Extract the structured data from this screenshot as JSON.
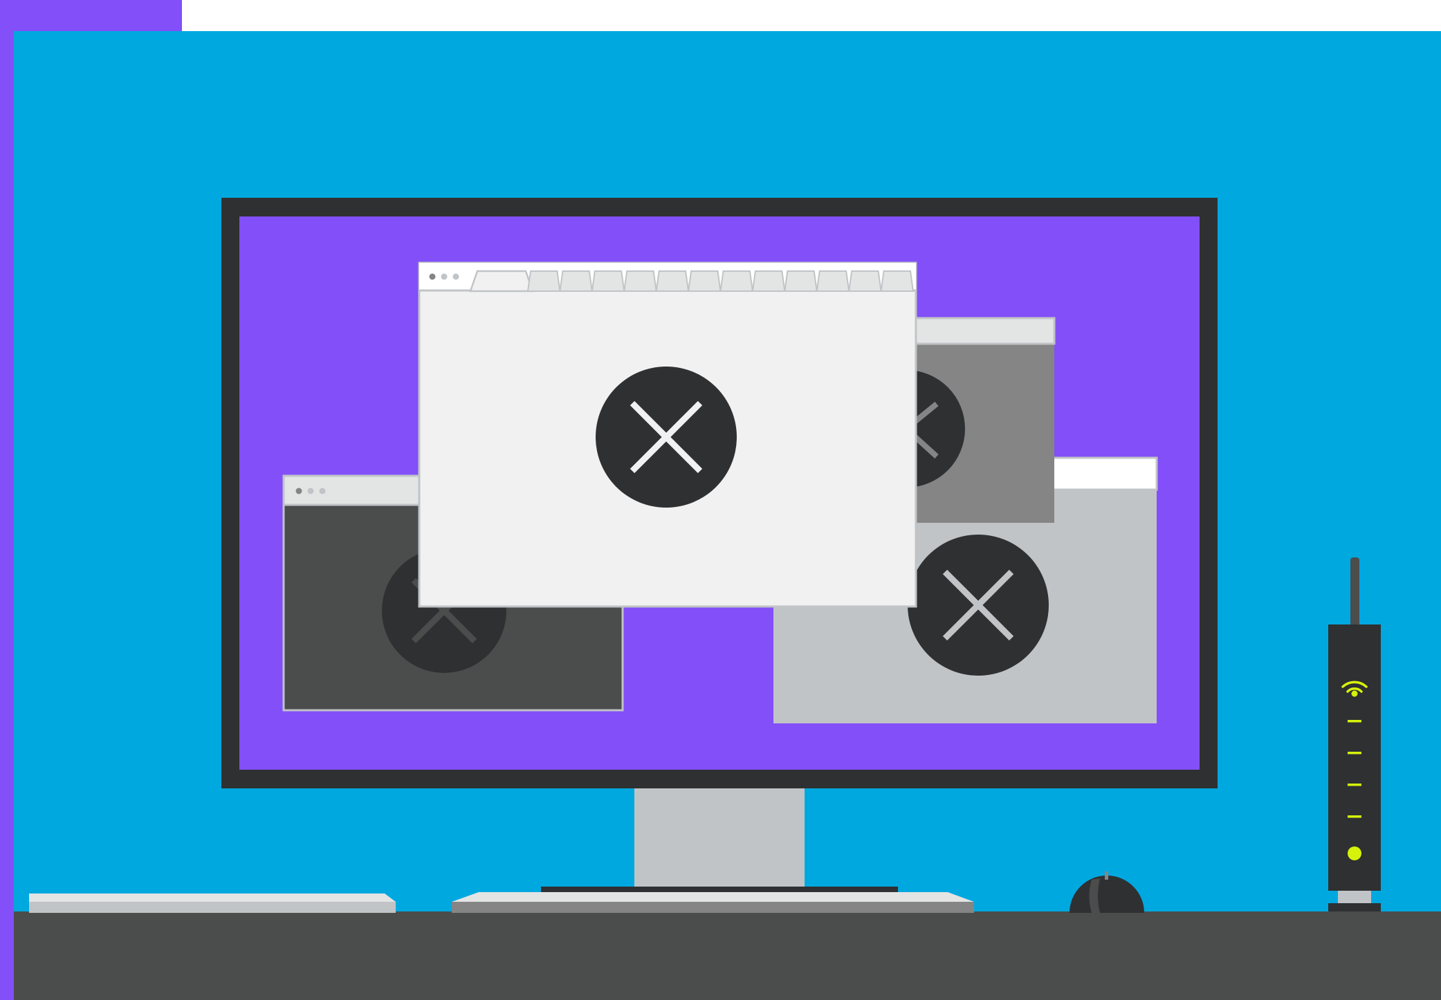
{
  "colors": {
    "accent_purple": "#834ff8",
    "sky_blue": "#00a8e0",
    "monitor_frame": "#2f3032",
    "monitor_stand": "#c1c4c7",
    "desk": "#4b4d4c",
    "window_light": "#f1f1f1",
    "window_chrome": "#e3e4e4",
    "window_dark": "#4b4d4c",
    "window_mid": "#858585",
    "window_silver": "#c1c4c7",
    "error_circle": "#2f3032",
    "router_led": "#d6f20b"
  },
  "scene": {
    "description_icons": [
      "error-x-icon",
      "wifi-icon",
      "status-dash-icon",
      "power-dot-icon"
    ]
  },
  "browser_windows": [
    {
      "id": "main",
      "theme": "light",
      "tab_count": 13,
      "status": "error"
    },
    {
      "id": "left",
      "theme": "dark",
      "status": "error"
    },
    {
      "id": "back",
      "theme": "grey",
      "status": "error"
    },
    {
      "id": "right",
      "theme": "silver",
      "status": "error"
    }
  ],
  "router": {
    "signal_lights": 4,
    "power_on": true
  }
}
